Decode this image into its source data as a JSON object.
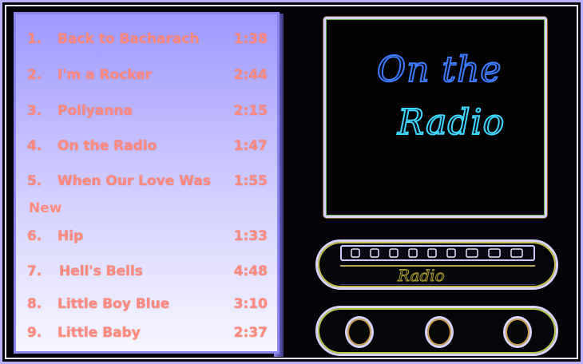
{
  "tracks": [
    {
      "num": "1.",
      "title": "Back to Bacharach",
      "duration": "1:38"
    },
    {
      "num": "2.",
      "title": "I'm a Rocker",
      "duration": "2:44"
    },
    {
      "num": "3.",
      "title": "Pollyanna",
      "duration": "2:15"
    },
    {
      "num": "4.",
      "title": "On the Radio",
      "duration": "1:47"
    },
    {
      "num": "5.",
      "title": "When Our Love Was",
      "duration": "1:55",
      "title_continued": "New"
    },
    {
      "num": "6.",
      "title": "Hip",
      "duration": "1:33"
    },
    {
      "num": "7.",
      "title": "Hell's Bells",
      "duration": "4:48"
    },
    {
      "num": "8.",
      "title": "Little Boy Blue",
      "duration": "3:10"
    },
    {
      "num": "9.",
      "title": "Little Baby",
      "duration": "2:37"
    }
  ],
  "radio": {
    "screen_line1": "On the",
    "screen_line2": "Radio",
    "dial_label": "Radio"
  },
  "colors": {
    "track_text": "#ff8a80",
    "screen_title_blue": "#3d7cff",
    "screen_title_cyan": "#3fd8ff",
    "panel_lavender": "#c2bdff"
  }
}
